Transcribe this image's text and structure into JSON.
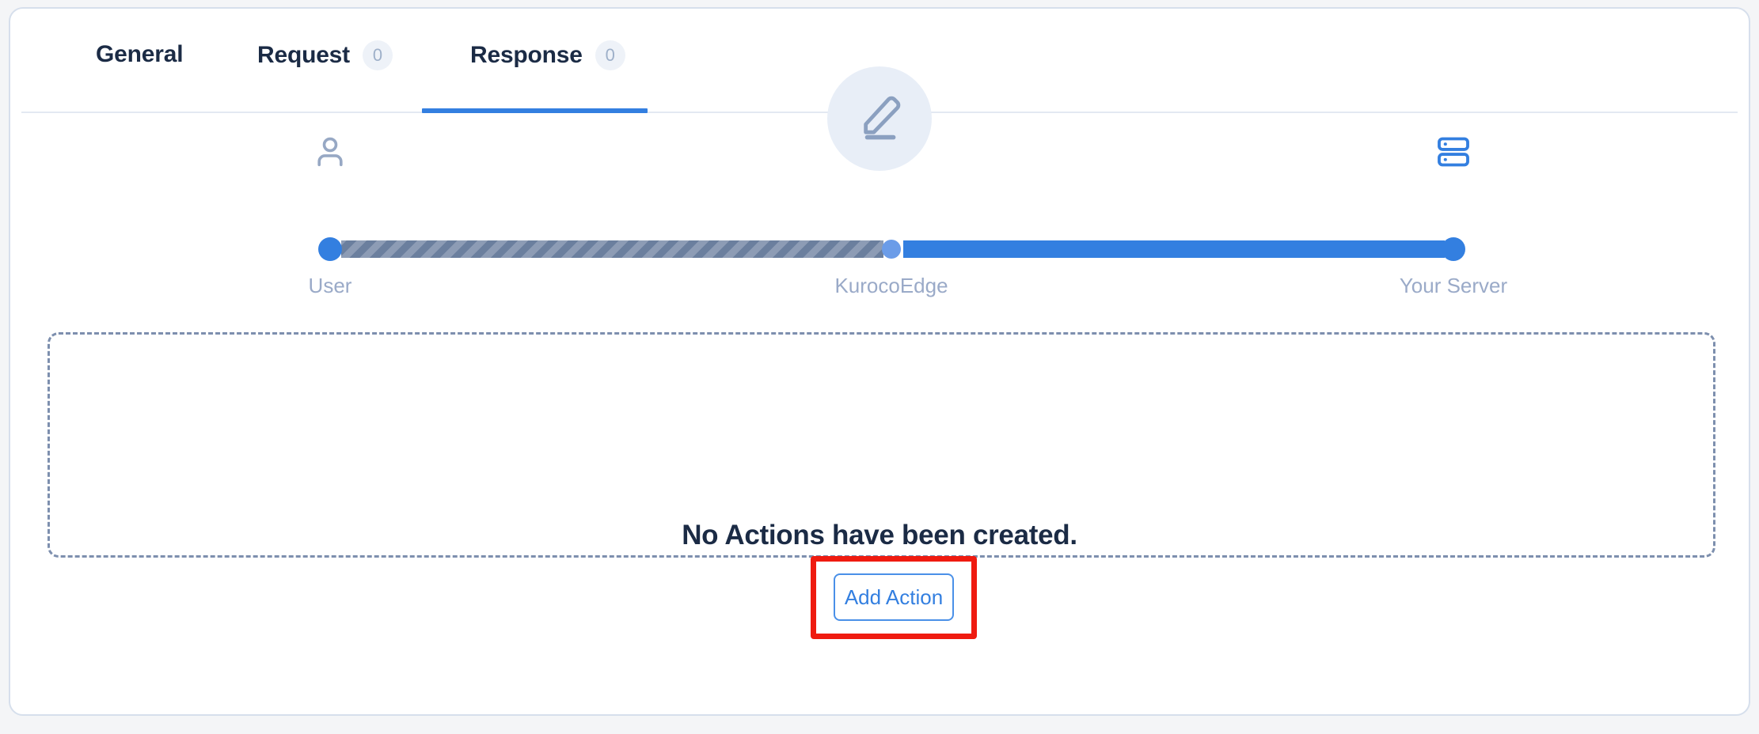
{
  "card": {
    "tabs": [
      {
        "id": "general",
        "label": "General",
        "badge": null,
        "active": false
      },
      {
        "id": "request",
        "label": "Request",
        "badge": "0",
        "active": false
      },
      {
        "id": "response",
        "label": "Response",
        "badge": "0",
        "active": true
      }
    ]
  },
  "flow": {
    "nodes": [
      {
        "id": "user",
        "label": "User",
        "icon": "user-icon",
        "dot_color": "#337fe0",
        "dot_size": 30
      },
      {
        "id": "kurocoedge",
        "label": "KurocoEdge",
        "icon": "arrow-left-icon",
        "dot_color": "#6b9ce8",
        "dot_size": 24
      },
      {
        "id": "your-server",
        "label": "Your Server",
        "icon": "server-icon",
        "dot_color": "#337fe0",
        "dot_size": 30
      }
    ],
    "segments": [
      {
        "id": "user-to-edge",
        "style": "striped",
        "color": "#7d8fae"
      },
      {
        "id": "edge-to-server",
        "style": "solid",
        "color": "#337fe0"
      }
    ],
    "direction": "response"
  },
  "empty_state": {
    "icon": "pencil-edit-icon",
    "title": "No Actions have been created.",
    "button_label": "Add Action"
  },
  "annotation": {
    "target": "Add Action",
    "color": "#ef1b10"
  }
}
